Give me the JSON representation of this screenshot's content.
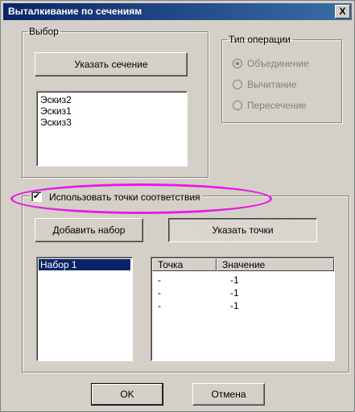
{
  "window": {
    "title": "Выталкивание по сечениям",
    "close_label": "X"
  },
  "selection_group": {
    "legend": "Выбор",
    "specify_section_button": "Указать сечение",
    "sketches": [
      "Эскиз2",
      "Эскиз1",
      "Эскиз3"
    ]
  },
  "operation_group": {
    "legend": "Тип операции",
    "options": [
      {
        "label": "Объединение",
        "selected": true
      },
      {
        "label": "Вычитание",
        "selected": false
      },
      {
        "label": "Пересечение",
        "selected": false
      }
    ]
  },
  "match_points": {
    "checkbox_label": "Использовать точки соответствия",
    "checked": true,
    "add_set_button": "Добавить набор",
    "specify_points_button": "Указать точки",
    "sets": [
      "Набор 1"
    ],
    "table": {
      "headers": [
        "Точка",
        "Значение"
      ],
      "rows": [
        [
          "-",
          "-1"
        ],
        [
          "-",
          "-1"
        ],
        [
          "-",
          "-1"
        ]
      ]
    }
  },
  "footer": {
    "ok_button": "OK",
    "cancel_button": "Отмена"
  },
  "colors": {
    "title_start": "#0a246a",
    "title_end": "#3a6ea5",
    "annotation": "#e619e6",
    "list_selection": "#0a246a"
  }
}
